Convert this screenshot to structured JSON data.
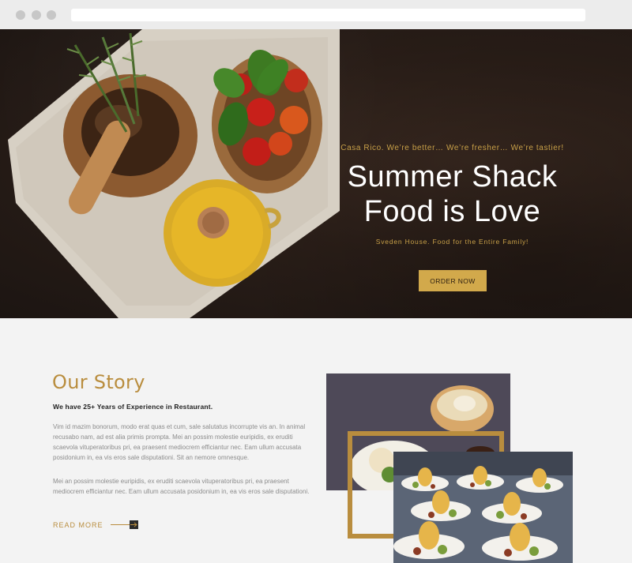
{
  "hero": {
    "kicker": "Casa Rico. We’re better… We’re fresher… We’re tastier!",
    "title_line1": "Summer Shack",
    "title_line2": "Food is Love",
    "subtitle": "Sveden House. Food for the Entire Family!",
    "cta_label": "ORDER NOW"
  },
  "story": {
    "title": "Our Story",
    "lead": "We have 25+ Years of Experience in Restaurant.",
    "paragraph1": "Vim id mazim bonorum, modo erat quas et cum, sale salutatus incorrupte vis an. In animal recusabo nam, ad est alia primis prompta. Mei an possim molestie euripidis, ex eruditi scaevola vituperatoribus pri, ea praesent mediocrem efficiantur nec. Eam ullum accusata posidonium in, ea vis eros sale disputationi. Sit an nemore omnesque.",
    "paragraph2": "Mei an possim molestie euripidis, ex eruditi scaevola vituperatoribus pri, ea praesent mediocrem efficiantur nec. Eam ullum accusata posidonium in, ea vis eros sale disputationi.",
    "read_more": "READ MORE"
  },
  "icons": {
    "read_more_arrow": "arrow-right-icon"
  },
  "colors": {
    "accent_gold": "#b98d3e",
    "button_gold": "#d2a94b",
    "hero_bg": "#2a1e18"
  }
}
